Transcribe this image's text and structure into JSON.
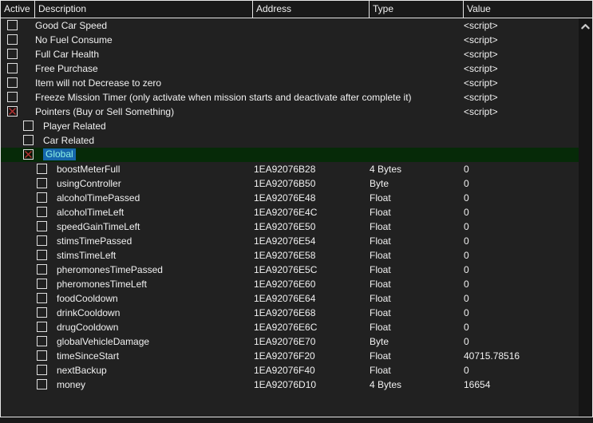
{
  "colors": {
    "panel_bg": "#212121",
    "header_bg": "#191919",
    "border_light": "#e6e6e6",
    "text": "#f1f1f1",
    "selected_row_bg": "#062a08",
    "selected_label_bg": "#1667ac",
    "selected_label_text": "#8df0e4",
    "checkbox_border": "#e0e0e0",
    "check_x": "#b83232",
    "scrollbar_track": "#151515",
    "scrollbar_arrow": "#c9c9c9"
  },
  "table": {
    "columns": [
      {
        "id": "active",
        "label": "Active"
      },
      {
        "id": "description",
        "label": "Description"
      },
      {
        "id": "address",
        "label": "Address"
      },
      {
        "id": "type",
        "label": "Type"
      },
      {
        "id": "value",
        "label": "Value"
      }
    ],
    "rows": [
      {
        "description": "Good Car Speed",
        "indent": 0,
        "checked": false,
        "selected": false,
        "address": "",
        "type": "",
        "value": "<script>"
      },
      {
        "description": "No Fuel Consume",
        "indent": 0,
        "checked": false,
        "selected": false,
        "address": "",
        "type": "",
        "value": "<script>"
      },
      {
        "description": "Full Car Health",
        "indent": 0,
        "checked": false,
        "selected": false,
        "address": "",
        "type": "",
        "value": "<script>"
      },
      {
        "description": "Free Purchase",
        "indent": 0,
        "checked": false,
        "selected": false,
        "address": "",
        "type": "",
        "value": "<script>"
      },
      {
        "description": "Item will not Decrease to zero",
        "indent": 0,
        "checked": false,
        "selected": false,
        "address": "",
        "type": "",
        "value": "<script>"
      },
      {
        "description": "Freeze Mission Timer (only activate when mission starts and deactivate after complete it)",
        "indent": 0,
        "checked": false,
        "selected": false,
        "address": "",
        "type": "",
        "value": "<script>"
      },
      {
        "description": "Pointers (Buy or Sell Something)",
        "indent": 0,
        "checked": true,
        "selected": false,
        "address": "",
        "type": "",
        "value": "<script>"
      },
      {
        "description": "Player Related",
        "indent": 1,
        "checked": false,
        "selected": false,
        "address": "",
        "type": "",
        "value": ""
      },
      {
        "description": "Car Related",
        "indent": 1,
        "checked": false,
        "selected": false,
        "address": "",
        "type": "",
        "value": ""
      },
      {
        "description": "Global",
        "indent": 1,
        "checked": true,
        "selected": true,
        "address": "",
        "type": "",
        "value": ""
      },
      {
        "description": "boostMeterFull",
        "indent": 2,
        "checked": false,
        "selected": false,
        "address": "1EA92076B28",
        "type": "4 Bytes",
        "value": "0"
      },
      {
        "description": "usingController",
        "indent": 2,
        "checked": false,
        "selected": false,
        "address": "1EA92076B50",
        "type": "Byte",
        "value": "0"
      },
      {
        "description": "alcoholTimePassed",
        "indent": 2,
        "checked": false,
        "selected": false,
        "address": "1EA92076E48",
        "type": "Float",
        "value": "0"
      },
      {
        "description": "alcoholTimeLeft",
        "indent": 2,
        "checked": false,
        "selected": false,
        "address": "1EA92076E4C",
        "type": "Float",
        "value": "0"
      },
      {
        "description": "speedGainTimeLeft",
        "indent": 2,
        "checked": false,
        "selected": false,
        "address": "1EA92076E50",
        "type": "Float",
        "value": "0"
      },
      {
        "description": "stimsTimePassed",
        "indent": 2,
        "checked": false,
        "selected": false,
        "address": "1EA92076E54",
        "type": "Float",
        "value": "0"
      },
      {
        "description": "stimsTimeLeft",
        "indent": 2,
        "checked": false,
        "selected": false,
        "address": "1EA92076E58",
        "type": "Float",
        "value": "0"
      },
      {
        "description": "pheromonesTimePassed",
        "indent": 2,
        "checked": false,
        "selected": false,
        "address": "1EA92076E5C",
        "type": "Float",
        "value": "0"
      },
      {
        "description": "pheromonesTimeLeft",
        "indent": 2,
        "checked": false,
        "selected": false,
        "address": "1EA92076E60",
        "type": "Float",
        "value": "0"
      },
      {
        "description": "foodCooldown",
        "indent": 2,
        "checked": false,
        "selected": false,
        "address": "1EA92076E64",
        "type": "Float",
        "value": "0"
      },
      {
        "description": "drinkCooldown",
        "indent": 2,
        "checked": false,
        "selected": false,
        "address": "1EA92076E68",
        "type": "Float",
        "value": "0"
      },
      {
        "description": "drugCooldown",
        "indent": 2,
        "checked": false,
        "selected": false,
        "address": "1EA92076E6C",
        "type": "Float",
        "value": "0"
      },
      {
        "description": "globalVehicleDamage",
        "indent": 2,
        "checked": false,
        "selected": false,
        "address": "1EA92076E70",
        "type": "Byte",
        "value": "0"
      },
      {
        "description": "timeSinceStart",
        "indent": 2,
        "checked": false,
        "selected": false,
        "address": "1EA92076F20",
        "type": "Float",
        "value": "40715.78516"
      },
      {
        "description": "nextBackup",
        "indent": 2,
        "checked": false,
        "selected": false,
        "address": "1EA92076F40",
        "type": "Float",
        "value": "0"
      },
      {
        "description": "money",
        "indent": 2,
        "checked": false,
        "selected": false,
        "address": "1EA92076D10",
        "type": "4 Bytes",
        "value": "16654"
      }
    ]
  }
}
